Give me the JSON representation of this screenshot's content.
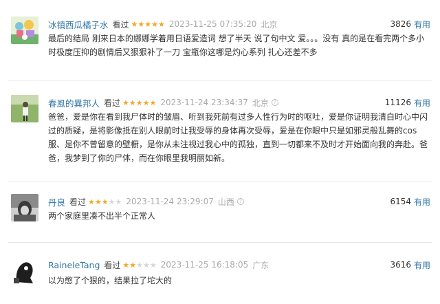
{
  "comments": [
    {
      "user": "冰镇西瓜橘子水",
      "watched_label": "看过",
      "rating": 5,
      "time": "2023-11-25 07:35:20",
      "location": "北京",
      "show_info_icon": false,
      "votes": "3826",
      "useful_label": "有用",
      "content": "最后的结局 刚来日本的娜娜学着用日语爱造词 想了半天 说了句中文 爱。。。没有 真的是在看完两个多小时极度压抑的剧情后又狠狠补了一刀 宝瓶你这哪是灼心系列 扎心还差不多"
    },
    {
      "user": "春風的異邦人",
      "watched_label": "看过",
      "rating": 5,
      "time": "2023-11-24 23:34:37",
      "location": "北京",
      "show_info_icon": true,
      "votes": "11126",
      "useful_label": "有用",
      "content": "爸爸，爱是你在看到我尸体时的皱眉、听到我死前有过多人性行为时的呕吐，爱是你证明我清白时心中闪过的质疑，是将影像抵在别人眼前时让我受辱的身体再次受辱，爱是在你眼中只是如邪灵般乱舞的cos服、是你不曾留意的壁橱，是你从未注视过我心中的孤独，直到一切都来不及时才开始面向我的奔赴。爸爸，我梦到了你的尸体，而在你眼里我明丽如新。"
    },
    {
      "user": "丹良",
      "watched_label": "看过",
      "rating": 3,
      "time": "2023-11-24 23:29:07",
      "location": "山西",
      "show_info_icon": true,
      "votes": "6154",
      "useful_label": "有用",
      "content": "两个家庭里凑不出半个正常人"
    },
    {
      "user": "RaineleTang",
      "watched_label": "看过",
      "rating": 2,
      "time": "2023-11-25 16:18:05",
      "location": "广东",
      "show_info_icon": false,
      "votes": "3616",
      "useful_label": "有用",
      "content": "以为憋了个狠的，结果拉了坨大的"
    }
  ]
}
